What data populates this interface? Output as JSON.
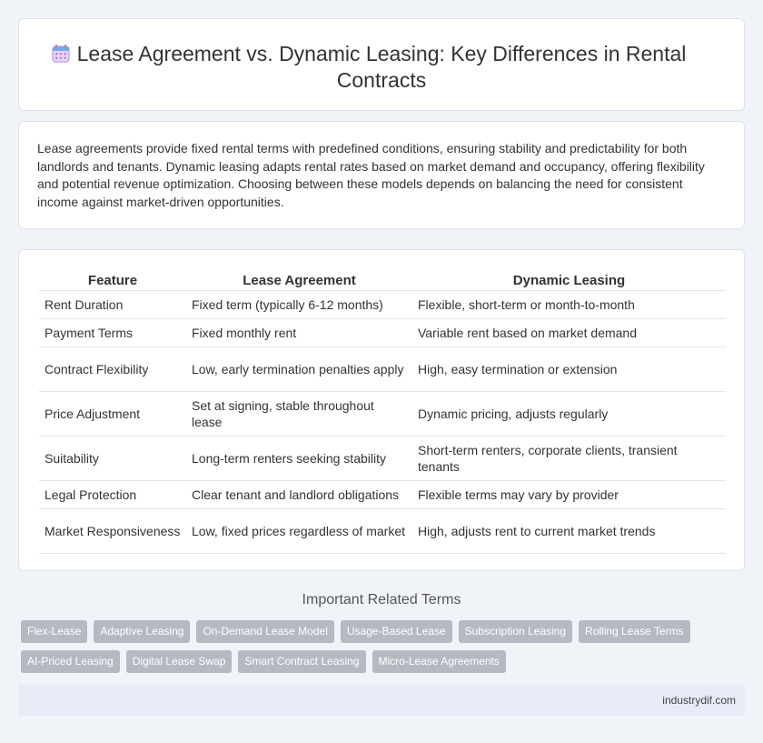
{
  "header": {
    "icon": "calendar-icon",
    "title": "Lease Agreement vs. Dynamic Leasing: Key Differences in Rental Contracts"
  },
  "intro": {
    "text": "Lease agreements provide fixed rental terms with predefined conditions, ensuring stability and predictability for both landlords and tenants. Dynamic leasing adapts rental rates based on market demand and occupancy, offering flexibility and potential revenue optimization. Choosing between these models depends on balancing the need for consistent income against market-driven opportunities."
  },
  "table": {
    "headers": [
      "Feature",
      "Lease Agreement",
      "Dynamic Leasing"
    ],
    "rows": [
      [
        "Rent Duration",
        "Fixed term (typically 6-12 months)",
        "Flexible, short-term or month-to-month"
      ],
      [
        "Payment Terms",
        "Fixed monthly rent",
        "Variable rent based on market demand"
      ],
      [
        "Contract Flexibility",
        "Low, early termination penalties apply",
        "High, easy termination or extension"
      ],
      [
        "Price Adjustment",
        "Set at signing, stable throughout lease",
        "Dynamic pricing, adjusts regularly"
      ],
      [
        "Suitability",
        "Long-term renters seeking stability",
        "Short-term renters, corporate clients, transient tenants"
      ],
      [
        "Legal Protection",
        "Clear tenant and landlord obligations",
        "Flexible terms may vary by provider"
      ],
      [
        "Market Responsiveness",
        "Low, fixed prices regardless of market",
        "High, adjusts rent to current market trends"
      ]
    ]
  },
  "related": {
    "title": "Important Related Terms",
    "tags_row1": [
      "Flex-Lease",
      "Adaptive Leasing",
      "On-Demand Lease Model",
      "Usage-Based Lease",
      "Subscription Leasing",
      "Rolling Lease Terms"
    ],
    "tags_row2": [
      "AI-Priced Leasing",
      "Digital Lease Swap",
      "Smart Contract Leasing",
      "Micro-Lease Agreements"
    ]
  },
  "footer": {
    "source": "industrydif.com"
  }
}
